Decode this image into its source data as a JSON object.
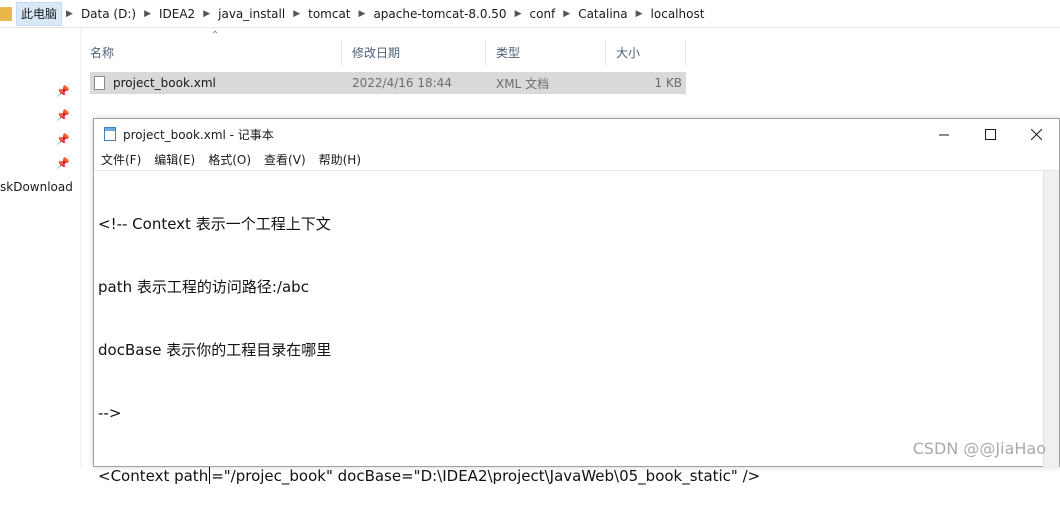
{
  "explorer": {
    "breadcrumbs": [
      "此电脑",
      "Data (D:)",
      "IDEA2",
      "java_install",
      "tomcat",
      "apache-tomcat-8.0.50",
      "conf",
      "Catalina",
      "localhost"
    ],
    "nav_label": "skDownload",
    "columns": {
      "name": "名称",
      "date": "修改日期",
      "type": "类型",
      "size": "大小"
    },
    "files": [
      {
        "name": "project_book.xml",
        "date": "2022/4/16 18:44",
        "type": "XML 文档",
        "size": "1 KB"
      }
    ]
  },
  "notepad": {
    "title": "project_book.xml - 记事本",
    "menu": [
      "文件(F)",
      "编辑(E)",
      "格式(O)",
      "查看(V)",
      "帮助(H)"
    ],
    "lines": [
      "<!-- Context 表示一个工程上下文",
      "path 表示工程的访问路径:/abc",
      "docBase 表示你的工程目录在哪里",
      "-->"
    ],
    "last_line_before_caret": "<Context path",
    "last_line_after_caret": "=\"/projec_book\" docBase=\"D:\\IDEA2\\project\\JavaWeb\\05_book_static\" />"
  },
  "watermark": "CSDN @@JiaHao"
}
